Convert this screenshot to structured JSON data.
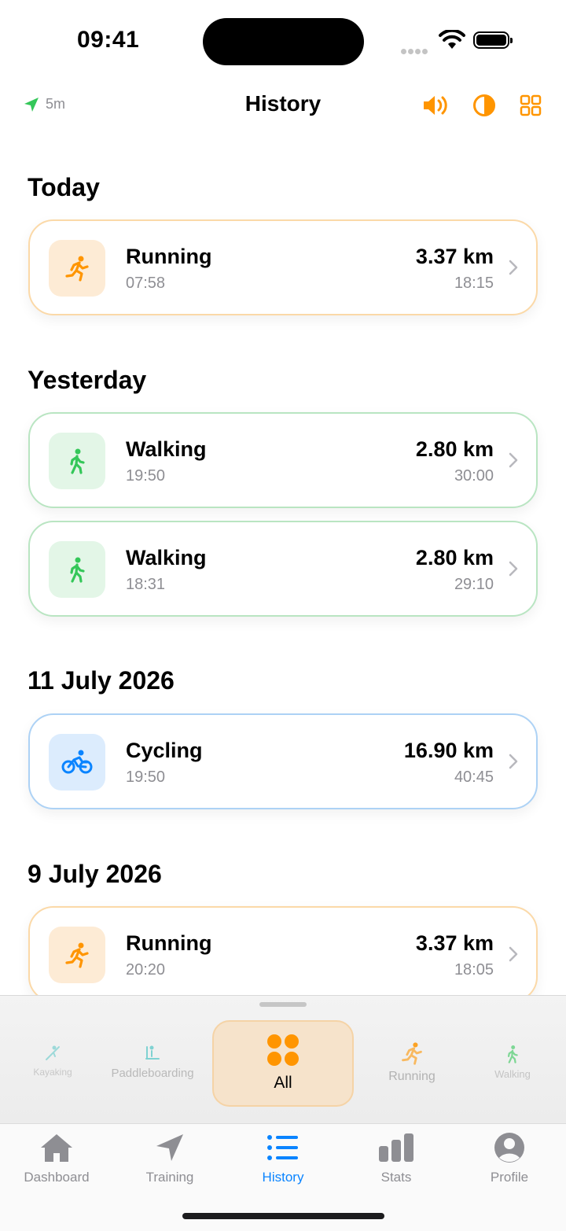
{
  "status_bar": {
    "time": "09:41"
  },
  "header": {
    "gps_label": "5m",
    "title": "History"
  },
  "colors": {
    "running": "#ff9500",
    "walking": "#34c759",
    "cycling": "#0a84ff",
    "active_tab": "#0a84ff"
  },
  "sections": [
    {
      "title": "Today"
    },
    {
      "title": "Yesterday"
    },
    {
      "title": "11 July 2026"
    },
    {
      "title": "9 July 2026"
    }
  ],
  "activities": [
    {
      "name": "Running",
      "time": "07:58",
      "distance": "3.37 km",
      "duration": "18:15",
      "type": "running",
      "icon": "running-icon"
    },
    {
      "name": "Walking",
      "time": "19:50",
      "distance": "2.80 km",
      "duration": "30:00",
      "type": "walking",
      "icon": "walking-icon"
    },
    {
      "name": "Walking",
      "time": "18:31",
      "distance": "2.80 km",
      "duration": "29:10",
      "type": "walking",
      "icon": "walking-icon"
    },
    {
      "name": "Cycling",
      "time": "19:50",
      "distance": "16.90 km",
      "duration": "40:45",
      "type": "cycling",
      "icon": "cycling-icon"
    },
    {
      "name": "Running",
      "time": "20:20",
      "distance": "3.37 km",
      "duration": "18:05",
      "type": "running",
      "icon": "running-icon"
    }
  ],
  "filters": [
    {
      "label": "Kayaking",
      "icon": "kayaking-icon"
    },
    {
      "label": "Paddleboarding",
      "icon": "paddleboarding-icon"
    },
    {
      "label": "All",
      "icon": "all-grid-icon",
      "selected": true
    },
    {
      "label": "Running",
      "icon": "running-icon"
    },
    {
      "label": "Walking",
      "icon": "walking-icon"
    }
  ],
  "tabs": [
    {
      "label": "Dashboard",
      "icon": "house-icon"
    },
    {
      "label": "Training",
      "icon": "location-arrow-icon"
    },
    {
      "label": "History",
      "icon": "list-icon",
      "active": true
    },
    {
      "label": "Stats",
      "icon": "bar-chart-icon"
    },
    {
      "label": "Profile",
      "icon": "person-circle-icon"
    }
  ]
}
